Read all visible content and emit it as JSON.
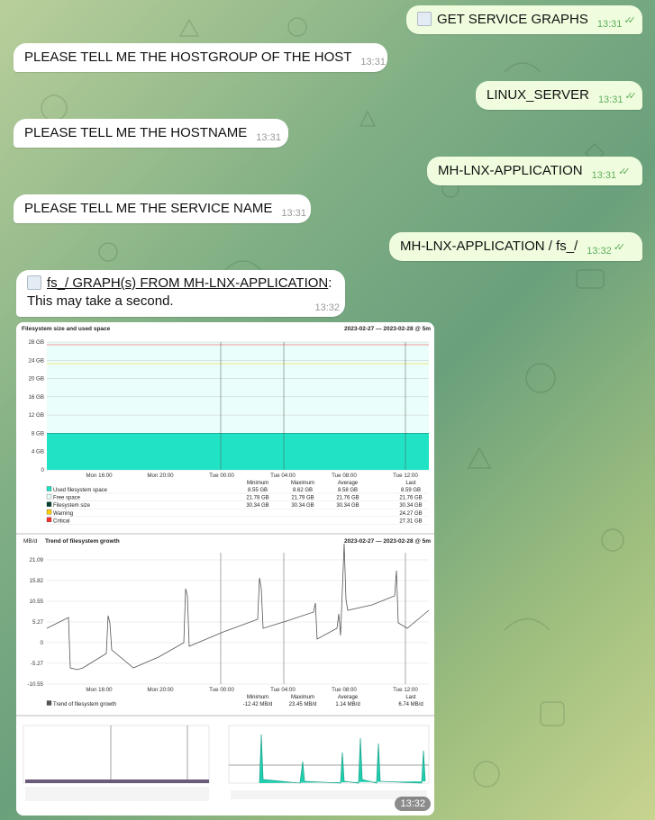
{
  "messages": {
    "m1": {
      "text": "GET SERVICE GRAPHS",
      "time": "13:31"
    },
    "m2": {
      "text": "PLEASE TELL ME THE HOSTGROUP OF THE HOST",
      "time": "13:31"
    },
    "m3": {
      "text": "LINUX_SERVER",
      "time": "13:31"
    },
    "m4": {
      "text": "PLEASE TELL ME THE HOSTNAME",
      "time": "13:31"
    },
    "m5": {
      "text": "MH-LNX-APPLICATION",
      "time": "13:31"
    },
    "m6": {
      "text": "PLEASE TELL ME THE SERVICE NAME",
      "time": "13:31"
    },
    "m7": {
      "text": "MH-LNX-APPLICATION / fs_/",
      "time": "13:32"
    },
    "m8": {
      "text_a": "fs_/ GRAPH(s) FROM MH-LNX-APPLICATION",
      "text_b": "This may take a second.",
      "time": "13:32"
    },
    "image_time": "13:32"
  },
  "graph1": {
    "title": "Filesystem size and used space",
    "range": "2023-02-27 — 2023-02-28 @ 5m",
    "yticks": [
      "28 GB",
      "24 GB",
      "20 GB",
      "16 GB",
      "12 GB",
      "8 GB",
      "4 GB",
      "0"
    ],
    "xticks": [
      "Mon 16:00",
      "Mon 20:00",
      "Tue 00:00",
      "Tue 04:00",
      "Tue 08:00",
      "Tue 12:00"
    ],
    "colheads": [
      "Minimum",
      "Maximum",
      "Average",
      "Last"
    ],
    "rows": [
      {
        "label": "Used filesystem space",
        "min": "8.55 GB",
        "max": "8.62 GB",
        "avg": "8.58 GB",
        "last": "8.59 GB",
        "color": "#1fe3c4"
      },
      {
        "label": "Free space",
        "min": "21.78 GB",
        "max": "21.79 GB",
        "avg": "21.76 GB",
        "last": "21.76 GB",
        "color": "#e8fffa"
      },
      {
        "label": "Filesystem size",
        "min": "30.34 GB",
        "max": "30.34 GB",
        "avg": "30.34 GB",
        "last": "30.34 GB",
        "color": "#004030"
      },
      {
        "label": "Warning",
        "min": "",
        "max": "",
        "avg": "",
        "last": "24.27 GB",
        "color": "#ffd000"
      },
      {
        "label": "Critical",
        "min": "",
        "max": "",
        "avg": "",
        "last": "27.31 GB",
        "color": "#ff3030"
      }
    ]
  },
  "graph2": {
    "title": "Trend of filesystem growth",
    "unit": "MB/d",
    "range": "2023-02-27 — 2023-02-28 @ 5m",
    "yticks": [
      "21.09",
      "15.82",
      "10.55",
      "5.27",
      "0",
      "-5.27",
      "-10.55"
    ],
    "xticks": [
      "Mon 16:00",
      "Mon 20:00",
      "Tue 00:00",
      "Tue 04:00",
      "Tue 08:00",
      "Tue 12:00"
    ],
    "colheads": [
      "Minimum",
      "Maximum",
      "Average",
      "Last"
    ],
    "rows": [
      {
        "label": "Trend of filesystem growth",
        "min": "-12.42 MB/d",
        "max": "23.45 MB/d",
        "avg": "1.14 MB/d",
        "last": "6.74 MB/d",
        "color": "#555555"
      }
    ]
  }
}
